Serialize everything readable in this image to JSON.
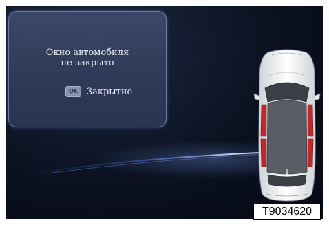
{
  "dialog": {
    "message_line1": "Окно автомобиля",
    "message_line2": "не закрыто",
    "ok_key_label": "OK",
    "action_label": "Закрытие"
  },
  "figure_code": "T9034620",
  "colors": {
    "screen_bg": "#0b1120",
    "dialog_bg": "#2e3a57",
    "open_window_indicator": "#c0282b",
    "text": "#e8ecf5"
  },
  "icons": {
    "ok_key": "ok-key-icon",
    "vehicle": "car-top-view-icon"
  },
  "vehicle_status": {
    "open_windows": [
      "front-left",
      "front-right",
      "rear-left",
      "rear-right"
    ]
  }
}
